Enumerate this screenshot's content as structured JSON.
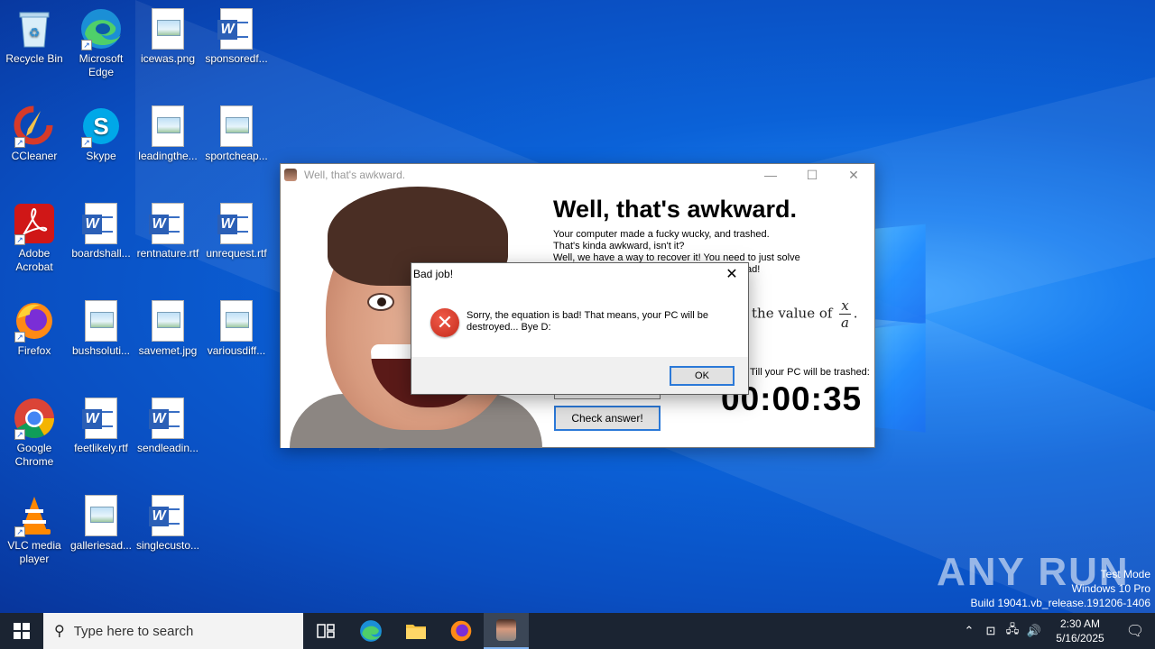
{
  "desktop": {
    "icons": [
      {
        "label": "Recycle Bin"
      },
      {
        "label": "Microsoft Edge"
      },
      {
        "label": "icewas.png"
      },
      {
        "label": "sponsoredf..."
      },
      {
        "label": "CCleaner"
      },
      {
        "label": "Skype"
      },
      {
        "label": "leadingthe..."
      },
      {
        "label": "sportcheap..."
      },
      {
        "label": "Adobe Acrobat"
      },
      {
        "label": "boardshall..."
      },
      {
        "label": "rentnature.rtf"
      },
      {
        "label": "unrequest.rtf"
      },
      {
        "label": "Firefox"
      },
      {
        "label": "bushsoluti..."
      },
      {
        "label": "savemet.jpg"
      },
      {
        "label": "variousdiff..."
      },
      {
        "label": "Google Chrome"
      },
      {
        "label": "feetlikely.rtf"
      },
      {
        "label": "sendleadin..."
      },
      {
        "label": "VLC media player"
      },
      {
        "label": "galleriesad..."
      },
      {
        "label": "singlecusto..."
      }
    ]
  },
  "app_window": {
    "title": "Well, that's awkward.",
    "headline": "Well, that's awkward.",
    "body_line1": "Your computer made a fucky wucky, and trashed.",
    "body_line2": "That's kinda awkward, isn't it?",
    "body_line3": "Well, we have a way to recover it! You need to just solve",
    "body_line4": "this simple equation! Nothing wrong, go ahead!",
    "equation_prefix": "the value of",
    "frac_numerator": "x",
    "frac_denominator": "a",
    "equation_suffix": ".",
    "trash_label": "Till your PC will be trashed:",
    "timer": "00:00:35",
    "check_button": "Check answer!"
  },
  "dialog": {
    "title": "Bad job!",
    "close_glyph": "✕",
    "message": "Sorry, the equation is bad! That means, your PC will be destroyed... Bye D:",
    "ok_label": "OK"
  },
  "watermark": {
    "brand": "ANY RUN",
    "mode": "Test Mode",
    "os": "Windows 10 Pro",
    "build": "Build 19041.vb_release.191206-1406"
  },
  "taskbar": {
    "search_placeholder": "Type here to search",
    "time": "2:30 AM",
    "date": "5/16/2025"
  },
  "colors": {
    "accent": "#2b79d8",
    "error": "#c42b1c",
    "taskbar": "#1b2432"
  }
}
